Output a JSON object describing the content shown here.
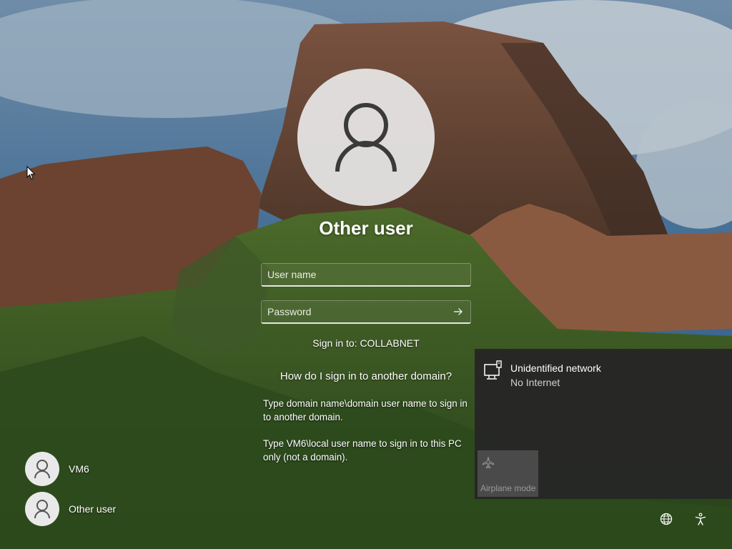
{
  "login": {
    "user_title": "Other user",
    "username_placeholder": "User name",
    "password_placeholder": "Password",
    "sign_in_to": "Sign in to: COLLABNET",
    "help_link": "How do I sign in to another domain?",
    "help_text_1": "Type domain name\\domain user name to sign in to another domain.",
    "help_text_2": "Type VM6\\local user name to sign in to this PC only (not a domain)."
  },
  "user_list": [
    {
      "name": "VM6",
      "icon": "user-avatar-icon"
    },
    {
      "name": "Other user",
      "icon": "user-avatar-icon"
    }
  ],
  "network_panel": {
    "network_name": "Unidentified network",
    "network_status": "No Internet",
    "airplane_label": "Airplane mode",
    "icons": [
      "ethernet-icon",
      "airplane-icon"
    ]
  },
  "bottom_icons": [
    "network-globe-icon",
    "accessibility-icon"
  ],
  "colors": {
    "panel_bg": "#262626",
    "airplane_tile_bg": "#4a4a4a",
    "avatar_bg": "#e8e8e8",
    "avatar_glyph": "#3a3a3a"
  }
}
